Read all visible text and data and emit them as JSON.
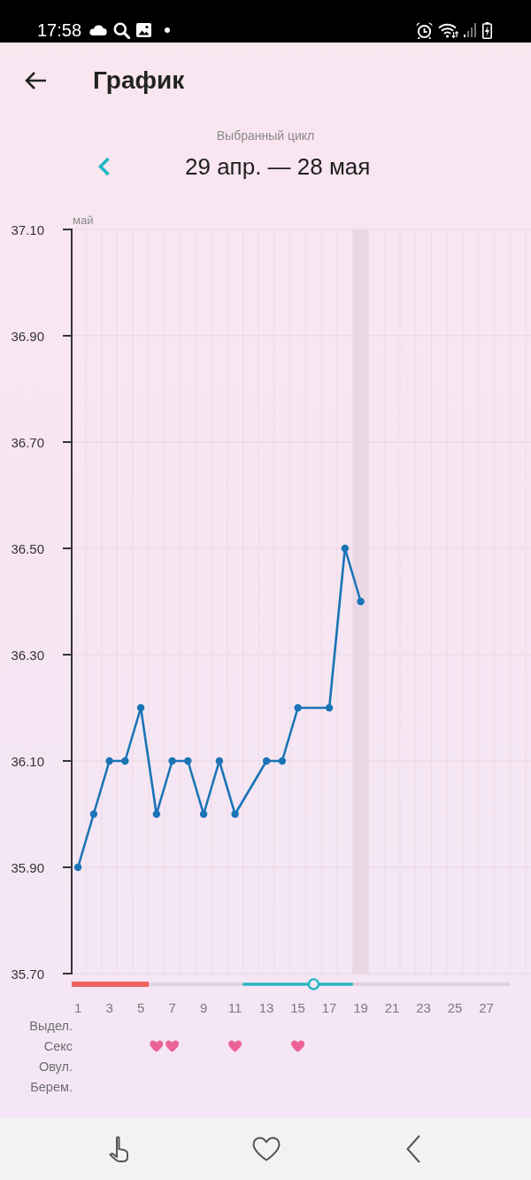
{
  "status_bar": {
    "time": "17:58"
  },
  "header": {
    "title": "График"
  },
  "cycle": {
    "caption": "Выбранный цикл",
    "range": "29 апр. — 28 мая"
  },
  "chart": {
    "month_label": "май",
    "chart_data": {
      "type": "line",
      "x": [
        1,
        2,
        3,
        4,
        5,
        6,
        7,
        8,
        9,
        10,
        11,
        12,
        13,
        14,
        15,
        16,
        17,
        18,
        19
      ],
      "values": [
        35.9,
        36.0,
        36.1,
        36.1,
        36.2,
        36.0,
        36.1,
        36.1,
        36.0,
        36.1,
        36.0,
        null,
        36.1,
        36.1,
        36.2,
        null,
        36.2,
        36.5,
        36.4
      ],
      "xlim": [
        0.6,
        29.84
      ],
      "ylim": [
        35.7,
        37.1
      ],
      "xticks": [
        1,
        3,
        5,
        7,
        9,
        11,
        13,
        15,
        17,
        19,
        21,
        23,
        25,
        27
      ],
      "yticks": [
        {
          "value": 35.7,
          "label": "35.70"
        },
        {
          "value": 35.9,
          "label": "35.90"
        },
        {
          "value": 36.1,
          "label": "36.10"
        },
        {
          "value": 36.3,
          "label": "36.30"
        },
        {
          "value": 36.5,
          "label": "36.50"
        },
        {
          "value": 36.7,
          "label": "36.70"
        },
        {
          "value": 36.9,
          "label": "36.90"
        },
        {
          "value": 37.1,
          "label": "37.10"
        }
      ],
      "grid": true,
      "marker": true,
      "bands": [
        {
          "axis": "x",
          "from": 18.5,
          "to": 19.5
        }
      ]
    },
    "cycle_days": [
      {
        "kind": "period"
      },
      {
        "kind": "period"
      },
      {
        "kind": "period"
      },
      {
        "kind": "period"
      },
      {
        "kind": "period"
      },
      {
        "kind": "plain"
      },
      {
        "kind": "plain"
      },
      {
        "kind": "plain"
      },
      {
        "kind": "plain"
      },
      {
        "kind": "plain"
      },
      {
        "kind": "plain"
      },
      {
        "kind": "fertile"
      },
      {
        "kind": "fertile"
      },
      {
        "kind": "fertile"
      },
      {
        "kind": "fertile"
      },
      {
        "kind": "ovulation"
      },
      {
        "kind": "fertile"
      },
      {
        "kind": "fertile"
      },
      {
        "kind": "plain"
      },
      {
        "kind": "plain"
      },
      {
        "kind": "plain"
      },
      {
        "kind": "plain"
      },
      {
        "kind": "plain"
      },
      {
        "kind": "plain"
      },
      {
        "kind": "plain"
      },
      {
        "kind": "plain"
      },
      {
        "kind": "plain"
      },
      {
        "kind": "plain"
      }
    ],
    "rows": [
      {
        "label": "Выдел."
      },
      {
        "label": "Секс",
        "days": [
          {
            "kind": "blank"
          },
          {
            "kind": "blank"
          },
          {
            "kind": "blank"
          },
          {
            "kind": "blank"
          },
          {
            "kind": "blank"
          },
          {
            "kind": "heart"
          },
          {
            "kind": "heart"
          },
          {
            "kind": "blank"
          },
          {
            "kind": "blank"
          },
          {
            "kind": "blank"
          },
          {
            "kind": "heart"
          },
          {
            "kind": "blank"
          },
          {
            "kind": "blank"
          },
          {
            "kind": "blank"
          },
          {
            "kind": "heart"
          }
        ]
      },
      {
        "label": "Овул."
      },
      {
        "label": "Берем."
      }
    ]
  }
}
